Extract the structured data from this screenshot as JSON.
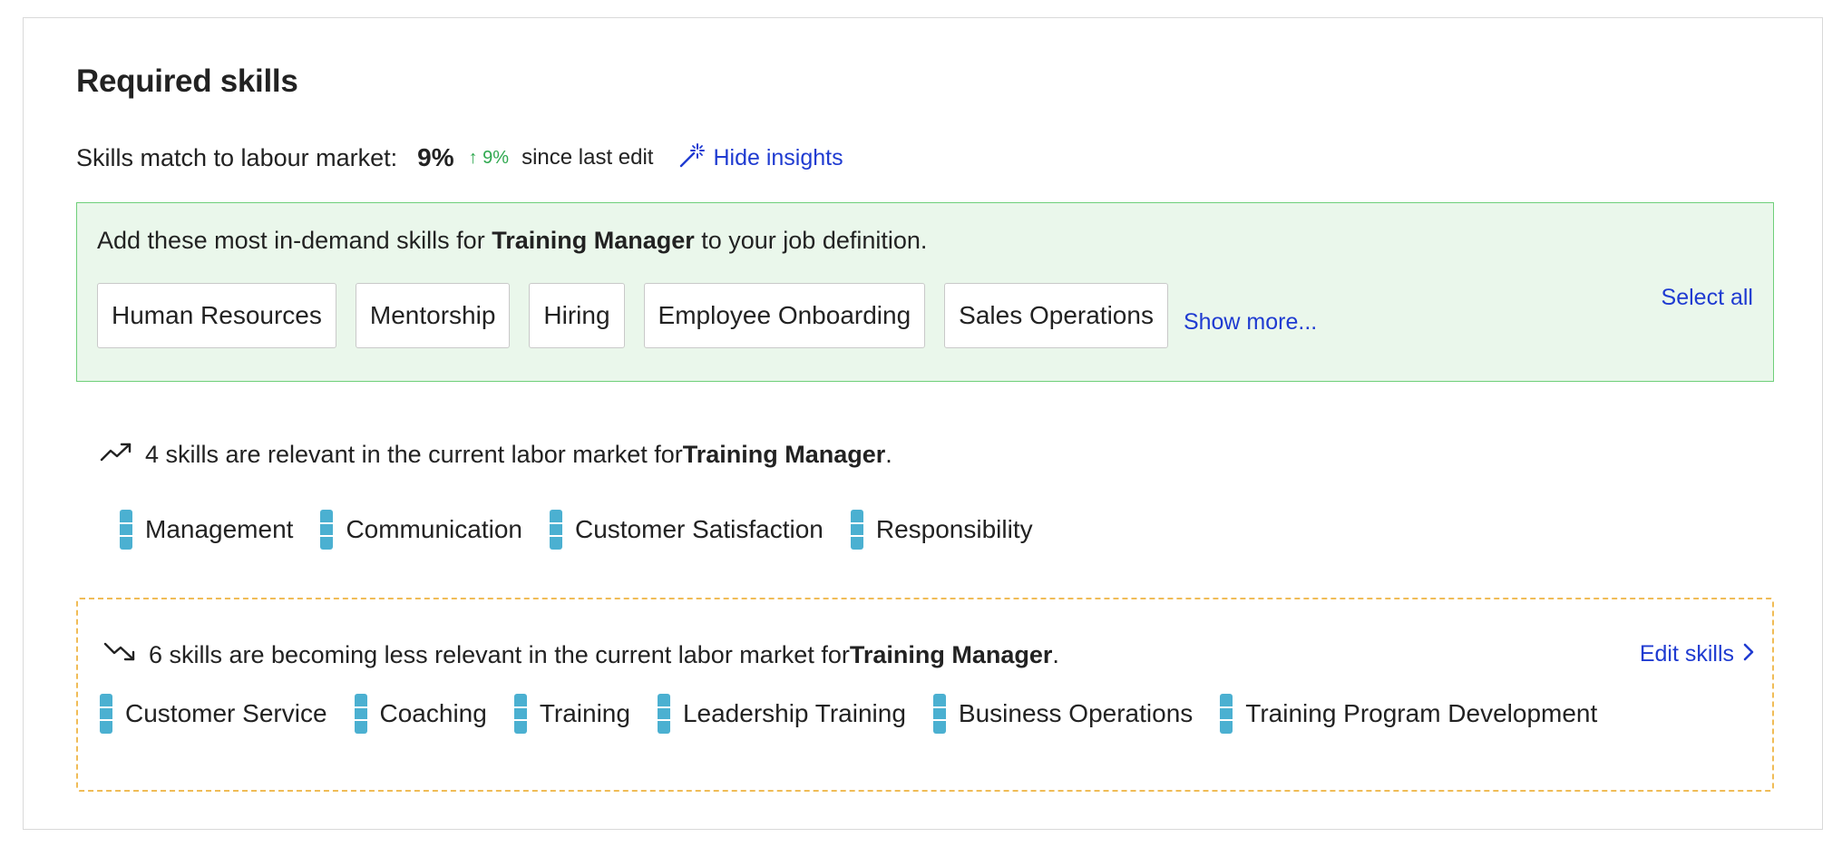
{
  "title": "Required skills",
  "match": {
    "label": "Skills match to labour market:",
    "value": "9%",
    "delta": "↑ 9%",
    "since": "since last edit",
    "insights_link": "Hide insights"
  },
  "suggestions": {
    "text_prefix": "Add these most in-demand skills for ",
    "role": "Training Manager",
    "text_suffix": " to your job definition.",
    "chips": [
      "Human Resources",
      "Mentorship",
      "Hiring",
      "Employee Onboarding",
      "Sales Operations"
    ],
    "show_more": "Show more...",
    "select_all": "Select all"
  },
  "relevant": {
    "text_prefix": "4 skills are relevant in the current labor market for ",
    "role": "Training Manager",
    "text_suffix": ".",
    "skills": [
      "Management",
      "Communication",
      "Customer Satisfaction",
      "Responsibility"
    ]
  },
  "declining": {
    "text_prefix": "6 skills are becoming less relevant in the current labor market for ",
    "role": "Training Manager",
    "text_suffix": ".",
    "edit_link": "Edit skills",
    "skills": [
      "Customer Service",
      "Coaching",
      "Training",
      "Leadership Training",
      "Business Operations",
      "Training Program Development"
    ]
  },
  "colors": {
    "accent_link": "#1f3bd1",
    "delta_green": "#2fa84f",
    "suggest_bg": "#eaf7eb",
    "suggest_border": "#6fcf7a",
    "declining_border": "#f0bc57",
    "skill_bar": "#4bb0d1"
  },
  "icons": {
    "insights": "magic-wand-icon",
    "trend_up": "trending-up-icon",
    "trend_down": "trending-down-icon",
    "chevron": "chevron-right-icon"
  }
}
